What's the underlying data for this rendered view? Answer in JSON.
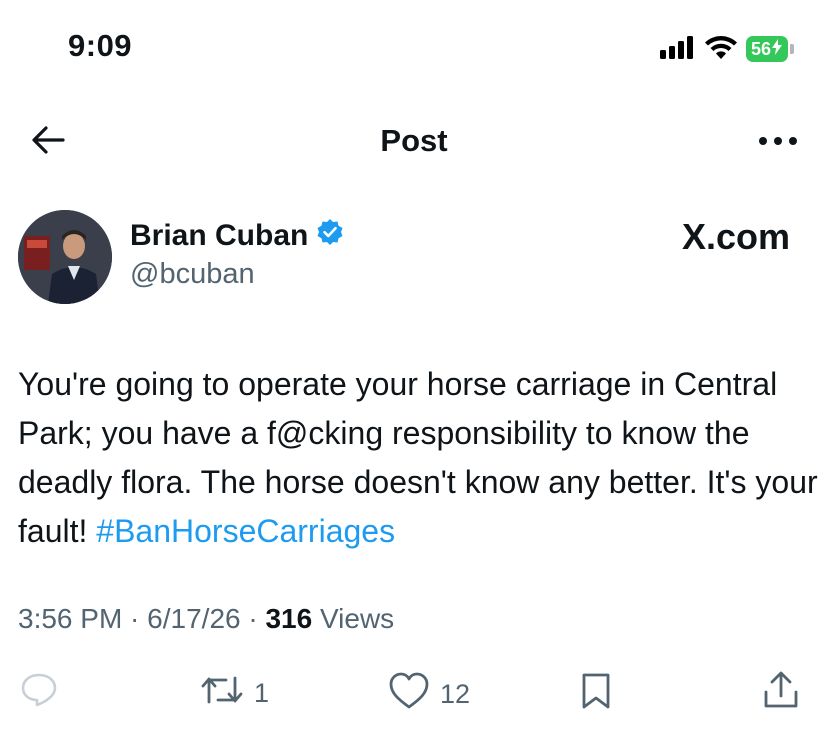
{
  "status_bar": {
    "time": "9:09",
    "battery": "56"
  },
  "header": {
    "title": "Post"
  },
  "author": {
    "name": "Brian Cuban",
    "handle": "@bcuban",
    "verified": true
  },
  "watermark": "X.com",
  "post": {
    "text": "You're going to operate your horse carriage in Central Park; you have a f@cking responsibility to know the deadly flora. The horse doesn't know any better. It's your fault! ",
    "hashtag": "#BanHorseCarriages"
  },
  "meta": {
    "time": "3:56 PM",
    "date": "6/17/26",
    "views_count": "316",
    "views_label": "Views"
  },
  "actions": {
    "reposts": "1",
    "likes": "12"
  },
  "colors": {
    "accent": "#1d9bf0",
    "secondary_text": "#536471",
    "battery": "#34c759"
  }
}
